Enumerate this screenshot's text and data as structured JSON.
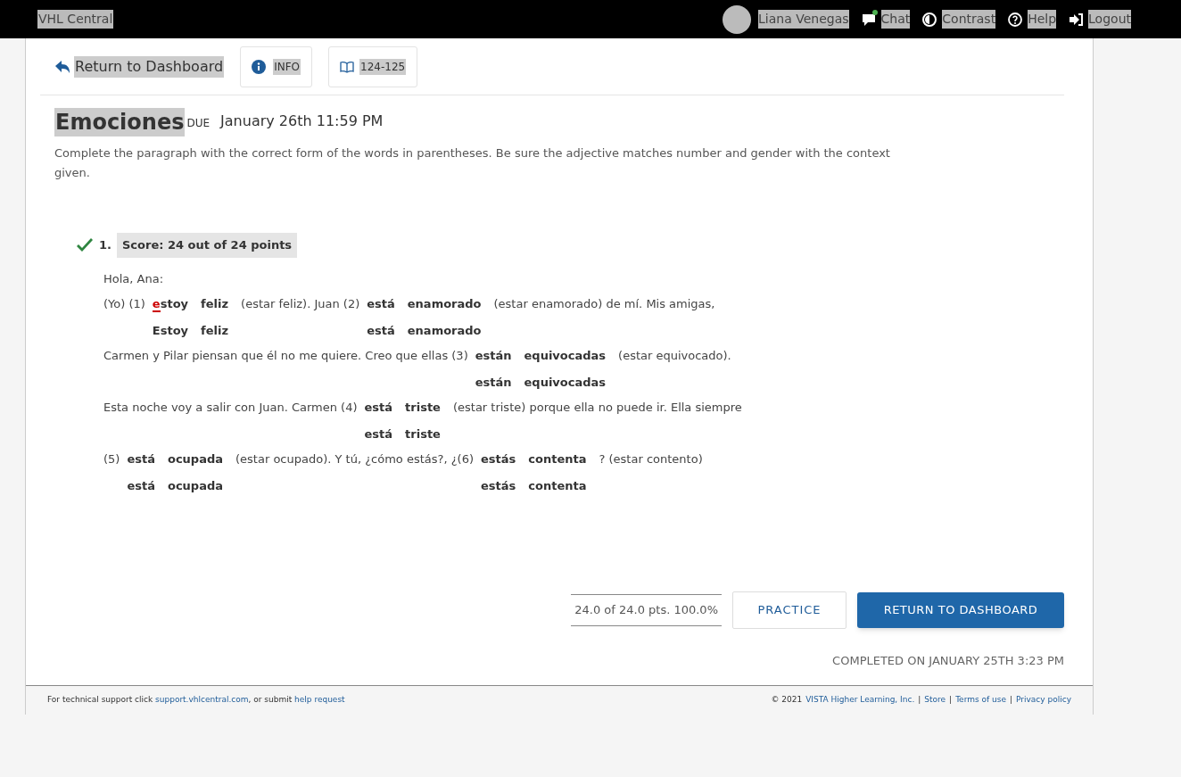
{
  "topbar": {
    "brand": "VHL Central",
    "user": "Liana Venegas",
    "links": [
      {
        "kind": "chat",
        "label": "Chat",
        "notify": true
      },
      {
        "kind": "contrast",
        "label": "Contrast"
      },
      {
        "kind": "help",
        "label": "Help"
      },
      {
        "kind": "logout",
        "label": "Logout"
      }
    ]
  },
  "nav": {
    "back": "Return to Dashboard",
    "info": "INFO",
    "pages": "124-125"
  },
  "assignment": {
    "title": "Emociones",
    "due_label": "DUE",
    "due": "January 26th 11:59 PM",
    "instructions": "Complete the paragraph with the correct form of the words in parentheses. Be sure the adjective matches number and gender with the context given."
  },
  "question": {
    "correct": true,
    "number": "1.",
    "score": "Score: 24 out of 24 points",
    "lines": [
      [
        {
          "kind": "text",
          "text": "Hola, Ana:"
        }
      ],
      [
        {
          "kind": "text",
          "text": "(Yo) (1)"
        },
        {
          "kind": "answer",
          "response": [
            {
              "text": "e",
              "error": true
            },
            {
              "text": "stoy",
              "error": false
            }
          ],
          "correct": "Estoy"
        },
        {
          "kind": "answer",
          "response": [
            {
              "text": "feliz",
              "error": false
            }
          ],
          "correct": "feliz"
        },
        {
          "kind": "text",
          "text": "(estar feliz). Juan (2)"
        },
        {
          "kind": "answer",
          "response": [
            {
              "text": "está",
              "error": false
            }
          ],
          "correct": "está"
        },
        {
          "kind": "answer",
          "response": [
            {
              "text": "enamorado",
              "error": false
            }
          ],
          "correct": "enamorado"
        },
        {
          "kind": "text",
          "text": "(estar enamorado) de mí. Mis amigas,"
        }
      ],
      [
        {
          "kind": "text",
          "text": "Carmen y Pilar piensan que él no me quiere. Creo que ellas (3)"
        },
        {
          "kind": "answer",
          "response": [
            {
              "text": "están",
              "error": false
            }
          ],
          "correct": "están"
        },
        {
          "kind": "answer",
          "response": [
            {
              "text": "equivocadas",
              "error": false
            }
          ],
          "correct": "equivocadas"
        },
        {
          "kind": "text",
          "text": "(estar equivocado)."
        }
      ],
      [
        {
          "kind": "text",
          "text": "Esta noche voy a salir con Juan. Carmen (4)"
        },
        {
          "kind": "answer",
          "response": [
            {
              "text": "está",
              "error": false
            }
          ],
          "correct": "está"
        },
        {
          "kind": "answer",
          "response": [
            {
              "text": "triste",
              "error": false
            }
          ],
          "correct": "triste"
        },
        {
          "kind": "text",
          "text": "(estar triste) porque ella no puede ir. Ella siempre"
        }
      ],
      [
        {
          "kind": "text",
          "text": "(5)"
        },
        {
          "kind": "answer",
          "response": [
            {
              "text": "está",
              "error": false
            }
          ],
          "correct": "está"
        },
        {
          "kind": "answer",
          "response": [
            {
              "text": "ocupada",
              "error": false
            }
          ],
          "correct": "ocupada"
        },
        {
          "kind": "text",
          "text": "(estar ocupado). Y tú, ¿cómo estás?, ¿(6)"
        },
        {
          "kind": "answer",
          "response": [
            {
              "text": "estás",
              "error": false
            }
          ],
          "correct": "estás"
        },
        {
          "kind": "answer",
          "response": [
            {
              "text": "contenta",
              "error": false
            }
          ],
          "correct": "contenta"
        },
        {
          "kind": "text",
          "text": "? (estar contento)"
        }
      ]
    ]
  },
  "result": {
    "points": "24.0 of 24.0 pts. 100.0%",
    "practice": "PRACTICE",
    "return": "RETURN TO DASHBOARD",
    "completed": "COMPLETED ON JANUARY 25TH 3:23 PM"
  },
  "footer": {
    "support_text": "For technical support click",
    "support_link": "support.vhlcentral.com",
    "or_text": ", or submit",
    "request_link": "help request",
    "copyright": "© 2021",
    "separator": "|",
    "links": [
      "VISTA Higher Learning, Inc.",
      "Store",
      "Terms of use",
      "Privacy policy"
    ]
  }
}
